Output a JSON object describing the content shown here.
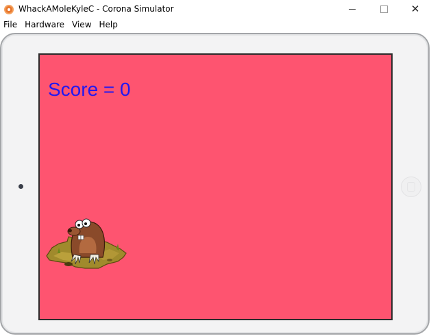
{
  "window": {
    "title": "WhackAMoleKyleC - Corona Simulator",
    "close_glyph": "✕"
  },
  "menu": {
    "items": [
      "File",
      "Hardware",
      "View",
      "Help"
    ]
  },
  "game": {
    "score_text": "Score = 0",
    "screen_color": "#fe5470",
    "score_color": "#2218f0"
  },
  "icons": {
    "app": "corona-icon",
    "mole": "mole-sprite"
  }
}
